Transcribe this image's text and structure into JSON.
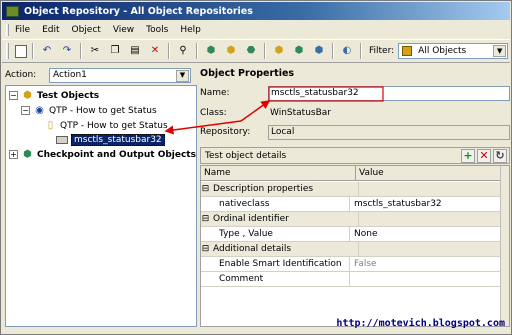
{
  "window": {
    "title": "Object Repository - All Object Repositories"
  },
  "menu": {
    "items": [
      {
        "label": "File",
        "key": "F"
      },
      {
        "label": "Edit",
        "key": "E"
      },
      {
        "label": "Object",
        "key": "O"
      },
      {
        "label": "View",
        "key": "V"
      },
      {
        "label": "Tools",
        "key": "T"
      },
      {
        "label": "Help",
        "key": "H"
      }
    ]
  },
  "toolbar": {
    "filter_label": "Filter:",
    "filter_value": "All Objects"
  },
  "left": {
    "action_label": "Action:",
    "action_value": "Action1",
    "tree": {
      "root_test_objects": "Test Objects",
      "child_qtp_1": "QTP - How to get Status",
      "child_qtp_2": "QTP - How to get Status",
      "selected_object": "msctls_statusbar32",
      "root_checkpoints": "Checkpoint and Output Objects"
    }
  },
  "right": {
    "header": "Object Properties",
    "name_label": "Name:",
    "name_value": "msctls_statusbar32",
    "class_label": "Class:",
    "class_value": "WinStatusBar",
    "repository_label": "Repository:",
    "repository_value": "Local",
    "details_title": "Test object details",
    "grid": {
      "col_name": "Name",
      "col_value": "Value",
      "rows": [
        {
          "type": "group",
          "name": "Description properties",
          "value": ""
        },
        {
          "type": "item",
          "name": "nativeclass",
          "value": "msctls_statusbar32"
        },
        {
          "type": "group",
          "name": "Ordinal identifier",
          "value": ""
        },
        {
          "type": "item",
          "name": "Type , Value",
          "value": "None"
        },
        {
          "type": "group",
          "name": "Additional details",
          "value": ""
        },
        {
          "type": "item",
          "name": "Enable Smart Identification",
          "value": "False"
        },
        {
          "type": "item",
          "name": "Comment",
          "value": ""
        }
      ]
    }
  },
  "watermark": "http://motevich.blogspot.com",
  "colors": {
    "title_bar": "#0a246a",
    "selection": "#0a246a",
    "arrow": "#e00000"
  }
}
